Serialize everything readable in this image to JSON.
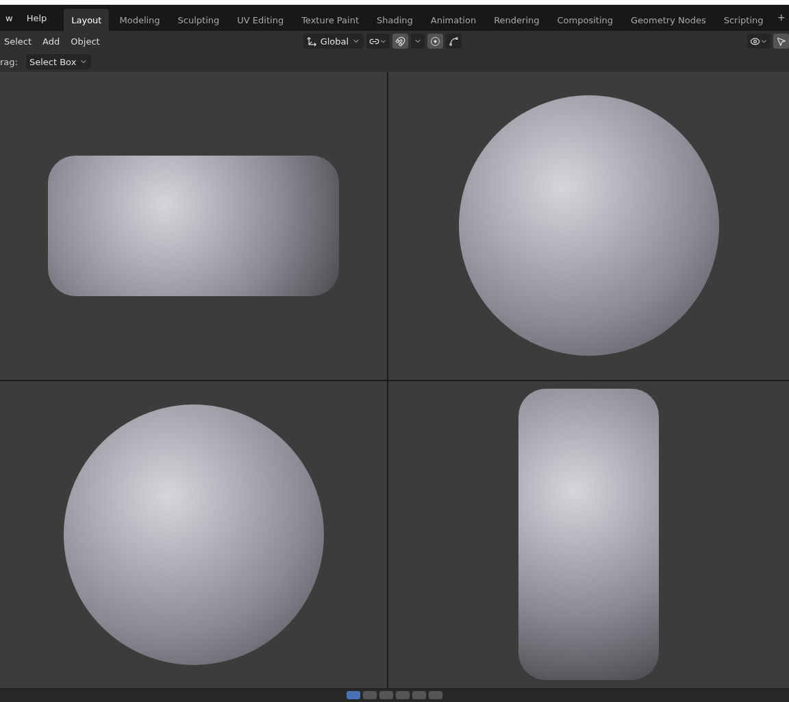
{
  "menu": [
    "w",
    "Help"
  ],
  "workspace_tabs": [
    {
      "label": "Layout",
      "selected": true
    },
    {
      "label": "Modeling",
      "selected": false
    },
    {
      "label": "Sculpting",
      "selected": false
    },
    {
      "label": "UV Editing",
      "selected": false
    },
    {
      "label": "Texture Paint",
      "selected": false
    },
    {
      "label": "Shading",
      "selected": false
    },
    {
      "label": "Animation",
      "selected": false
    },
    {
      "label": "Rendering",
      "selected": false
    },
    {
      "label": "Compositing",
      "selected": false
    },
    {
      "label": "Geometry Nodes",
      "selected": false
    },
    {
      "label": "Scripting",
      "selected": false
    }
  ],
  "add_tab": "+",
  "header_menu": [
    "Select",
    "Add",
    "Object"
  ],
  "orientation": {
    "value": "Global"
  },
  "tool_settings": {
    "label": "rag:",
    "value": "Select Box"
  },
  "viewports": [
    {
      "kind": "wide"
    },
    {
      "kind": "round"
    },
    {
      "kind": "round"
    },
    {
      "kind": "tall"
    }
  ]
}
